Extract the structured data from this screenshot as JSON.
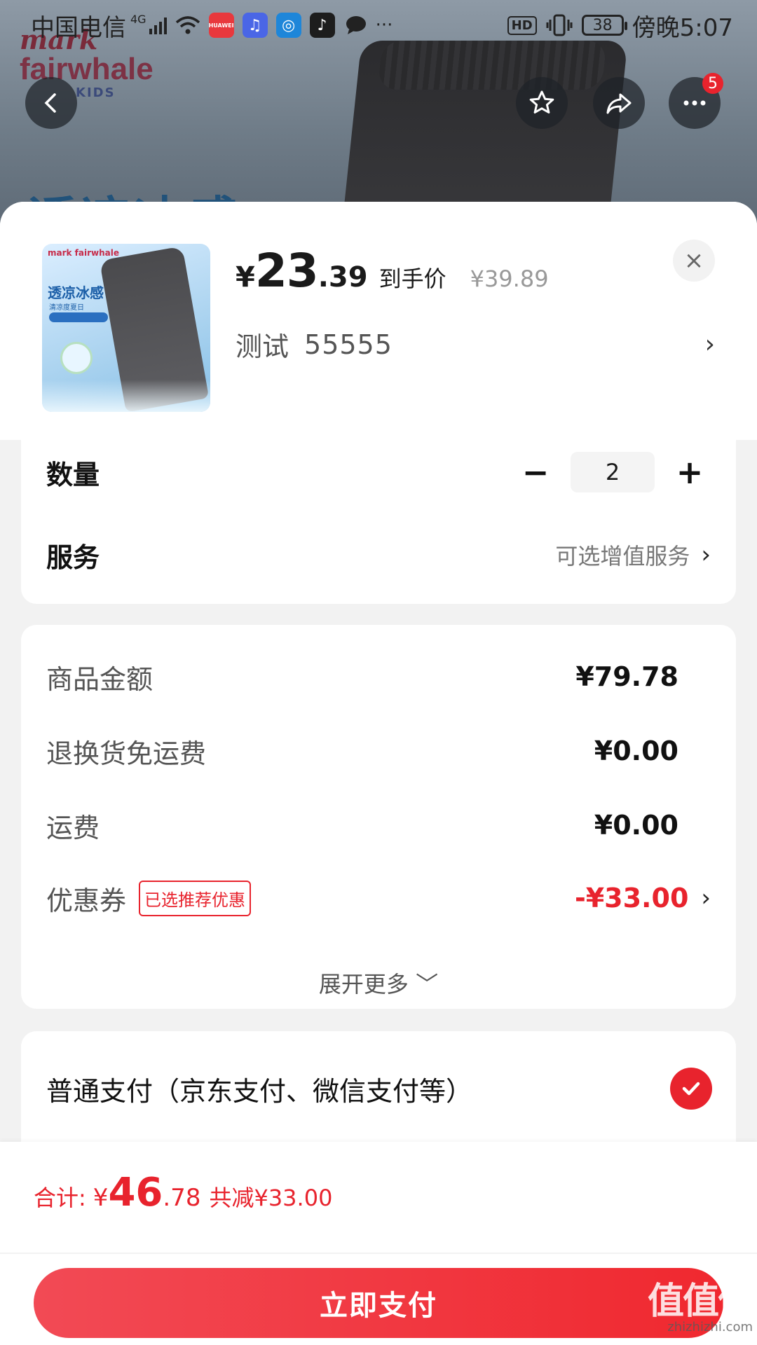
{
  "status_bar": {
    "carrier": "中国电信",
    "network": "4G",
    "more": "···",
    "hd": "HD",
    "battery": "38",
    "time": "傍晚5:07",
    "apps": [
      {
        "name": "huawei-app-icon",
        "label": "HUAWEI",
        "color": "#e8383d"
      },
      {
        "name": "music-app-icon",
        "label": "♫",
        "color": "#4a66e6"
      },
      {
        "name": "browser-app-icon",
        "label": "◎",
        "color": "#1e86d9"
      },
      {
        "name": "tiktok-app-icon",
        "label": "♪",
        "color": "#1d1d1d"
      }
    ]
  },
  "background": {
    "logo_line1": "mark",
    "logo_line2": "fairwhale",
    "logo_line3": "KIDS",
    "title": "透凉冰感"
  },
  "nav": {
    "more_badge": "5"
  },
  "product": {
    "thumb_logo": "mark fairwhale",
    "thumb_title": "透凉冰感",
    "thumb_sub": "清凉度夏日",
    "price_symbol": "¥",
    "price_int": "23",
    "price_dec": ".39",
    "price_tag": "到手价",
    "original_price": "¥39.89",
    "sku_a": "测试",
    "sku_b": "55555",
    "chevron": "›",
    "close": "×"
  },
  "quantity": {
    "label": "数量",
    "minus": "−",
    "value": "2",
    "plus": "+"
  },
  "service": {
    "label": "服务",
    "value": "可选增值服务",
    "chevron": "›"
  },
  "fees": {
    "goods_label": "商品金额",
    "goods_value": "¥79.78",
    "return_label": "退换货免运费",
    "return_value": "¥0.00",
    "shipping_label": "运费",
    "shipping_value": "¥0.00",
    "coupon_label": "优惠券",
    "coupon_tag": "已选推荐优惠",
    "coupon_value": "-¥33.00",
    "chevron": "›",
    "expand": "展开更多 ﹀"
  },
  "payment": {
    "option_label": "普通支付（京东支付、微信支付等）"
  },
  "footer": {
    "total_label": "合计:",
    "total_symbol": "¥",
    "total_int": "46",
    "total_dec": ".78",
    "total_reduce": "共减¥33.00",
    "pay_button": "立即支付"
  },
  "watermark": {
    "line1": "值值值",
    "line2": "zhizhizhi.com"
  },
  "colors": {
    "accent_red": "#e8232d",
    "sheet_bg": "#f2f2f2"
  }
}
